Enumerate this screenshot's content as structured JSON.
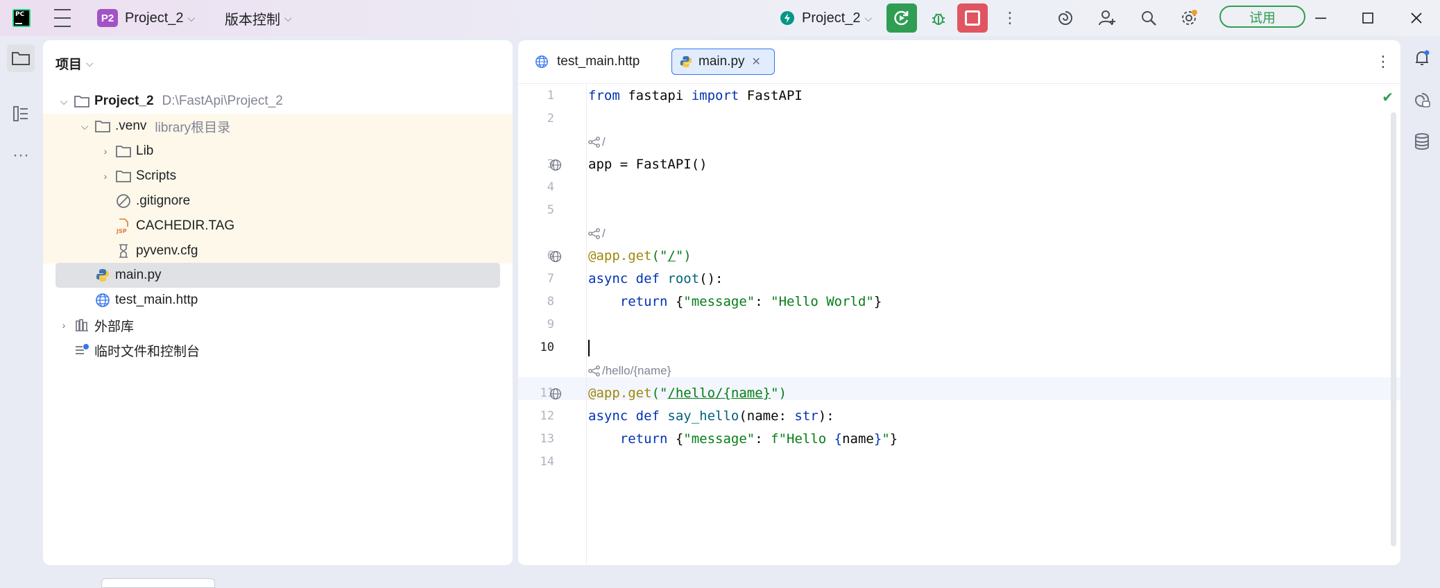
{
  "titlebar": {
    "project_badge": "P2",
    "project_name": "Project_2",
    "vcs_label": "版本控制",
    "run_config": "Project_2",
    "trial_label": "试用"
  },
  "project_panel": {
    "title": "项目",
    "tree": [
      {
        "label": "Project_2",
        "hint": "D:\\FastApi\\Project_2"
      },
      {
        "label": ".venv",
        "hint": "library根目录"
      },
      {
        "label": "Lib"
      },
      {
        "label": "Scripts"
      },
      {
        "label": ".gitignore"
      },
      {
        "label": "CACHEDIR.TAG"
      },
      {
        "label": "pyvenv.cfg"
      },
      {
        "label": "main.py"
      },
      {
        "label": "test_main.http"
      },
      {
        "label": "外部库"
      },
      {
        "label": "临时文件和控制台"
      }
    ]
  },
  "editor": {
    "tabs": [
      {
        "label": "test_main.http"
      },
      {
        "label": "main.py"
      }
    ],
    "line_numbers": [
      "1",
      "2",
      "3",
      "4",
      "5",
      "6",
      "7",
      "8",
      "9",
      "10",
      "11",
      "12",
      "13",
      "14"
    ],
    "hints": [
      "/",
      "/",
      "/hello/{name}"
    ],
    "code": {
      "l1_kw1": "from",
      "l1_mod": " fastapi ",
      "l1_kw2": "import",
      "l1_name": " FastAPI",
      "l3": "app = FastAPI()",
      "l6_dec": "@app.get",
      "l6_open": "(\"",
      "l6_path": "/",
      "l6_close": "\")",
      "l7_kw": "async def",
      "l7_fn": " root",
      "l7_rest": "():",
      "l8_indent": "    ",
      "l8_kw": "return",
      "l8_sp": " {",
      "l8_key": "\"message\"",
      "l8_colon": ": ",
      "l8_val": "\"Hello World\"",
      "l8_end": "}",
      "l11_dec": "@app.get",
      "l11_open": "(\"",
      "l11_path": "/hello/{name}",
      "l11_close": "\")",
      "l12_kw": "async def",
      "l12_fn": " say_hello",
      "l12_args": "(name: ",
      "l12_type": "str",
      "l12_end": "):",
      "l13_indent": "    ",
      "l13_kw": "return",
      "l13_sp": " {",
      "l13_key": "\"message\"",
      "l13_colon": ": ",
      "l13_f": "f\"Hello ",
      "l13_brace1": "{",
      "l13_name": "name",
      "l13_brace2": "}",
      "l13_q": "\"",
      "l13_end": "}"
    }
  },
  "colors": {
    "keyword": "#0033b3",
    "decorator": "#9e880d",
    "string": "#067d17",
    "run": "#2f9e52",
    "stop": "#e05562",
    "project_badge": "#a253c6"
  }
}
